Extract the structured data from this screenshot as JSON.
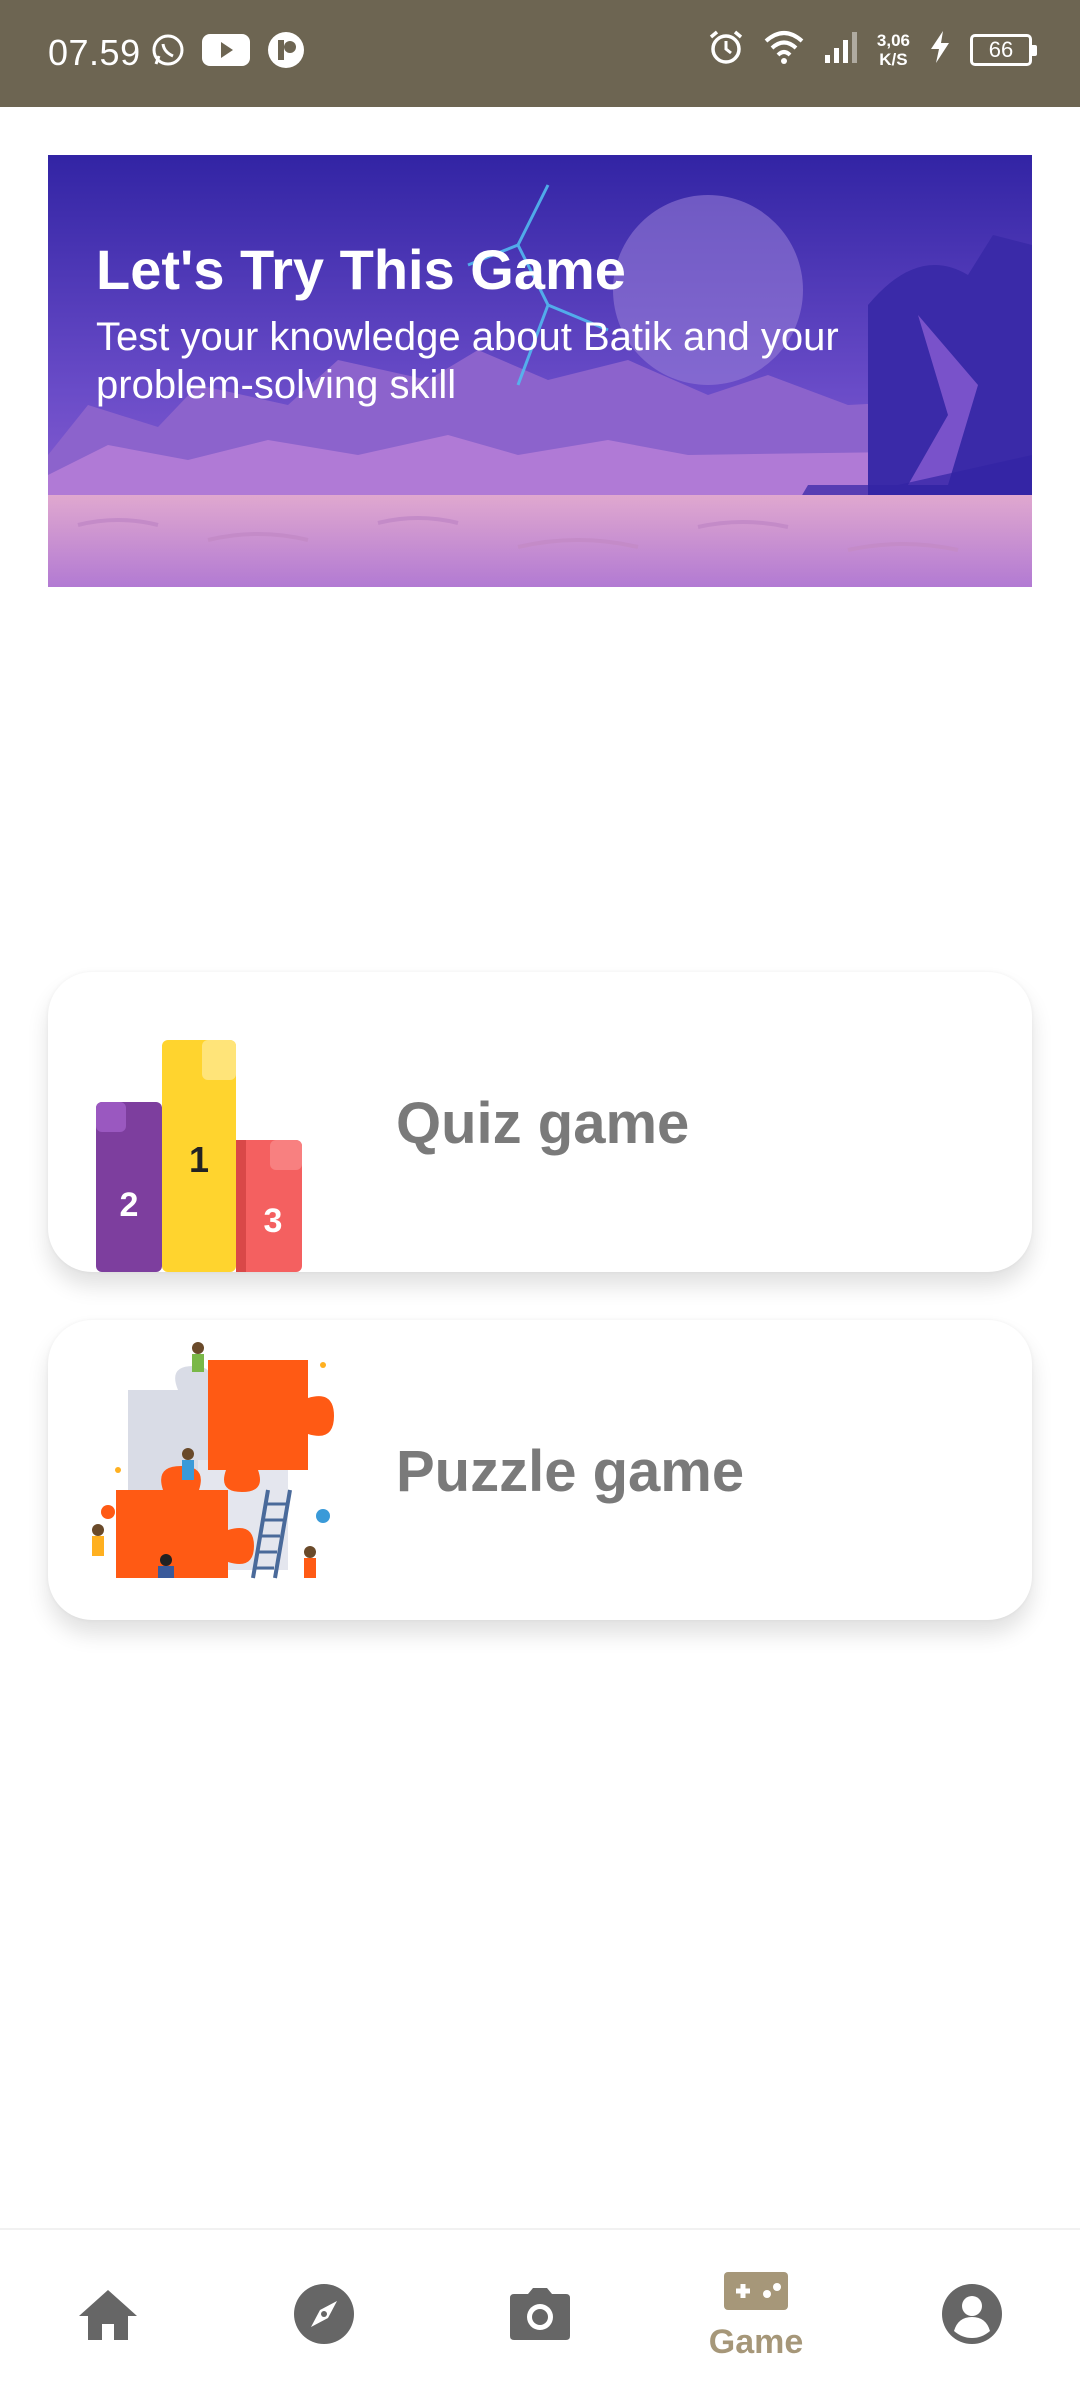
{
  "status_bar": {
    "time": "07.59",
    "net_speed_value": "3,06",
    "net_speed_unit": "K/S",
    "battery": "66",
    "icons": [
      "whatsapp-icon",
      "youtube-icon",
      "app-icon",
      "alarm-icon",
      "wifi-icon",
      "signal-icon",
      "charging-icon",
      "battery-icon"
    ]
  },
  "banner": {
    "title": "Let's Try This Game",
    "subtitle": "Test your knowledge about Batik and your problem-solving skill"
  },
  "games": [
    {
      "label": "Quiz game",
      "illustration": "podium-illustration",
      "podium": [
        "2",
        "1",
        "3"
      ]
    },
    {
      "label": "Puzzle game",
      "illustration": "puzzle-illustration"
    }
  ],
  "bottom_nav": {
    "items": [
      {
        "icon": "home-icon",
        "label": ""
      },
      {
        "icon": "compass-icon",
        "label": ""
      },
      {
        "icon": "camera-icon",
        "label": ""
      },
      {
        "icon": "gamepad-icon",
        "label": "Game"
      },
      {
        "icon": "account-icon",
        "label": ""
      }
    ],
    "active_index": 3
  },
  "colors": {
    "status_bar": "#6d6552",
    "nav_icon": "#666666",
    "nav_active": "#a69779",
    "card_text": "#7a7a7a",
    "puzzle_orange": "#ff5a14",
    "podium_purple": "#7d3e9e",
    "podium_yellow": "#ffd42e",
    "podium_red": "#f46060"
  }
}
